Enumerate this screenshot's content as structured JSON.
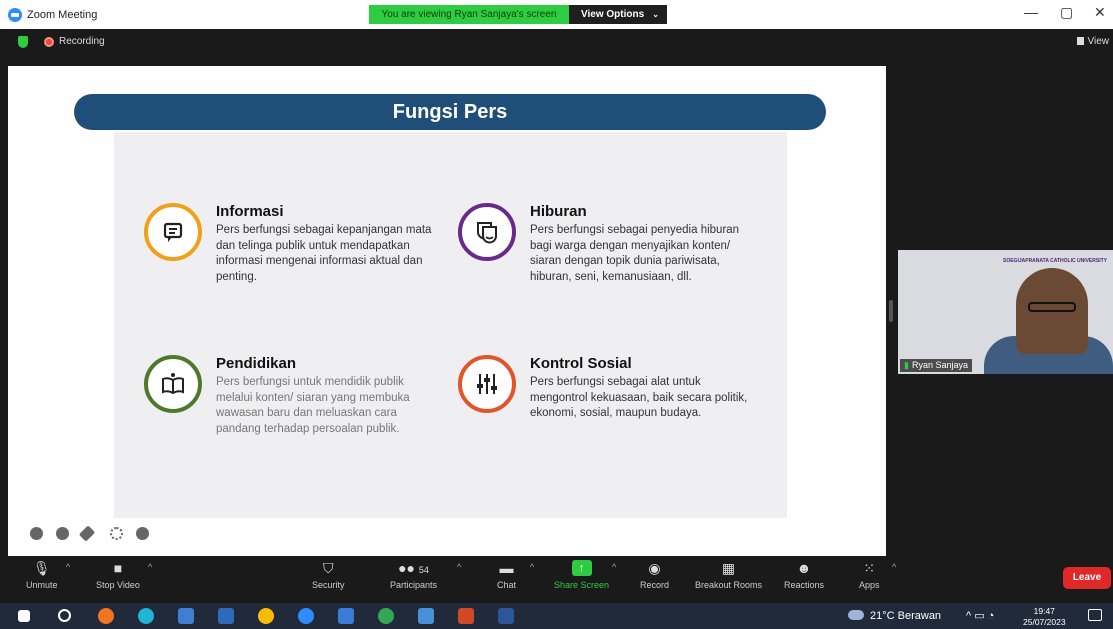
{
  "window": {
    "title": "Zoom Meeting",
    "viewing_banner": "You are viewing Ryan Sanjaya's screen",
    "view_options": "View Options",
    "minimize": "—",
    "restore": "▢",
    "close": "✕"
  },
  "status": {
    "recording": "Recording",
    "view": "View"
  },
  "slide": {
    "title": "Fungsi Pers",
    "items": [
      {
        "title": "Informasi",
        "text": "Pers berfungsi sebagai kepanjangan mata dan telinga publik untuk mendapatkan informasi mengenai informasi aktual dan penting.",
        "color": "#f2a01a",
        "icon": "chat-bubble-icon"
      },
      {
        "title": "Hiburan",
        "text": "Pers berfungsi sebagai penyedia hiburan bagi warga dengan menyajikan konten/ siaran dengan topik dunia pariwisata, hiburan, seni, kemanusiaan, dll.",
        "color": "#6a2a8c",
        "icon": "theater-masks-icon"
      },
      {
        "title": "Pendidikan",
        "text": "Pers berfungsi untuk mendidik publik melalui konten/ siaran yang membuka wawasan baru dan meluaskan cara pandang terhadap persoalan publik.",
        "color": "#4d7a2a",
        "icon": "open-book-icon"
      },
      {
        "title": "Kontrol Sosial",
        "text": "Pers berfungsi sebagai alat untuk mengontrol kekuasaan, baik secara politik, ekonomi, sosial, maupun budaya.",
        "color": "#e0562a",
        "icon": "sliders-icon"
      }
    ]
  },
  "video": {
    "participant_name": "Ryan Sanjaya",
    "logo_text": "SOEGIJAPRANATA CATHOLIC UNIVERSITY"
  },
  "toolbar": {
    "unmute": "Unmute",
    "stop_video": "Stop Video",
    "security": "Security",
    "participants": "Participants",
    "participants_count": "54",
    "chat": "Chat",
    "share_screen": "Share Screen",
    "record": "Record",
    "breakout_rooms": "Breakout Rooms",
    "reactions": "Reactions",
    "apps": "Apps",
    "leave": "Leave"
  },
  "taskbar": {
    "weather": "21°C Berawan",
    "time": "19:47",
    "date": "25/07/2023"
  }
}
